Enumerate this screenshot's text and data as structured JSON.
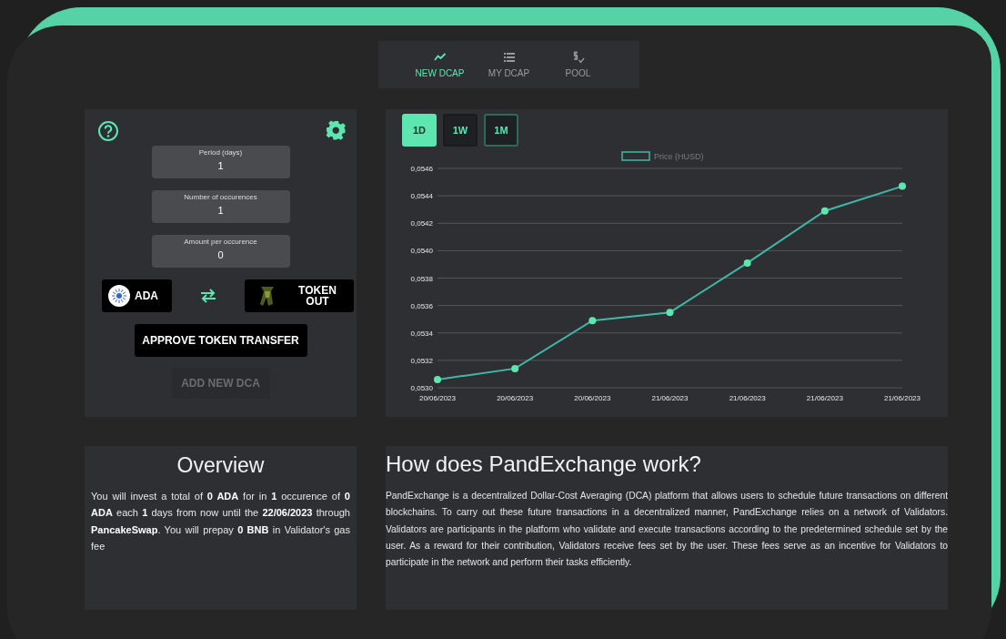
{
  "nav_tabs": [
    {
      "label": "NEW DCAP",
      "kind": "chart",
      "selected": true
    },
    {
      "label": "MY DCAP",
      "kind": "list",
      "selected": false
    },
    {
      "label": "POOL",
      "kind": "dollar",
      "selected": false
    }
  ],
  "form": {
    "fields": [
      {
        "label": "Period (days)",
        "value": "1"
      },
      {
        "label": "Number of occurences",
        "value": "1"
      },
      {
        "label": "Amount per occurence",
        "value": "0"
      }
    ],
    "token_in": {
      "label": "ADA"
    },
    "token_out": {
      "label": "TOKEN OUT"
    },
    "approve_button": {
      "label": "APPROVE TOKEN TRANSFER"
    },
    "add_button": {
      "label": "ADD NEW DCA",
      "disabled": true
    }
  },
  "range_tabs": [
    {
      "label": "1D",
      "selected": true,
      "focused": false
    },
    {
      "label": "1W",
      "selected": false,
      "focused": false
    },
    {
      "label": "1M",
      "selected": false,
      "focused": true
    }
  ],
  "chart": {
    "chart_data": {
      "type": "line",
      "grid": true,
      "categories": [
        "20/06/2023",
        "20/06/2023",
        "20/06/2023",
        "21/06/2023",
        "21/06/2023",
        "21/06/2023",
        "21/06/2023"
      ],
      "series": [
        {
          "name": "Price (HUSD)",
          "color": "#3fb8a8",
          "marker": true,
          "values": [
            0.05306,
            0.05314,
            0.05349,
            0.05355,
            0.05391,
            0.05429,
            0.05447
          ]
        }
      ],
      "ylim": [
        0.053,
        0.0546
      ],
      "yticks": [
        {
          "value": 0.053,
          "label": "0,0530"
        },
        {
          "value": 0.0532,
          "label": "0,0532"
        },
        {
          "value": 0.0534,
          "label": "0,0534"
        },
        {
          "value": 0.0536,
          "label": "0,0536"
        },
        {
          "value": 0.0538,
          "label": "0,0538"
        },
        {
          "value": 0.054,
          "label": "0,0540"
        },
        {
          "value": 0.0542,
          "label": "0,0542"
        },
        {
          "value": 0.0544,
          "label": "0,0544"
        },
        {
          "value": 0.0546,
          "label": "0,0546"
        }
      ]
    }
  },
  "overview": {
    "title": "Overview",
    "text": "You will invest a total of **0 ADA** for in **1** occurence of **0 ADA** each **1** days from now until the **22/06/2023** through **PancakeSwap**. You will prepay **0 BNB** in Validator's gas fee"
  },
  "about": {
    "title": "How does PandExchange work?",
    "text": "PandExchange is a decentralized Dollar-Cost Averaging (DCA) platform that allows users to schedule future transactions on different blockchains. To carry out these future transactions in a decentralized manner, PandExchange relies on a network of Validators. Validators are participants in the platform who validate and execute transactions according to the predetermined schedule set by the user. As a reward for their contribution, Validators receive fees set by the user. These fees serve as an incentive for Validators to participate in the network and perform their tasks efficiently."
  }
}
